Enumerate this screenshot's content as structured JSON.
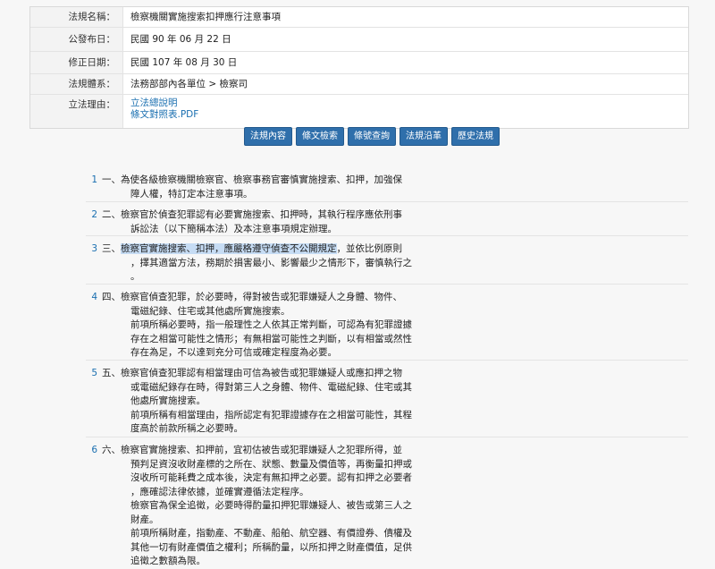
{
  "meta": {
    "rows": [
      {
        "label": "法規名稱：",
        "value": "檢察機關實施搜索扣押應行注意事項"
      },
      {
        "label": "公發布日：",
        "value": "民國 90 年 06 月 22 日"
      },
      {
        "label": "修正日期：",
        "value": "民國 107 年 08 月 30 日"
      },
      {
        "label": "法規體系：",
        "value": "法務部部內各單位 > 檢察司"
      }
    ],
    "reason_label": "立法理由：",
    "reason_links": [
      "立法總說明",
      "條文對照表.PDF"
    ]
  },
  "buttons": [
    "法規內容",
    "條文檢索",
    "條號查詢",
    "法規沿革",
    "歷史法規"
  ],
  "articles": [
    {
      "no": "1",
      "lines": [
        "一、為使各級檢察機關檢察官、檢察事務官審慎實施搜索、扣押，加強保",
        "障人權，特訂定本注意事項。"
      ]
    },
    {
      "no": "2",
      "lines": [
        "二、檢察官於偵查犯罪認有必要實施搜索、扣押時，其執行程序應依刑事",
        "訴訟法（以下簡稱本法）及本注意事項規定辦理。"
      ]
    },
    {
      "no": "3",
      "highlight": "檢察官實施搜索、扣押，應嚴格遵守偵查不公開規定",
      "first_rest": "，並依比例原則",
      "prefix": "三、",
      "lines": [
        "，擇其適當方法，務期於損害最小、影響最少之情形下，審慎執行之",
        "。"
      ]
    },
    {
      "no": "4",
      "lines": [
        "四、檢察官偵查犯罪，於必要時，得對被告或犯罪嫌疑人之身體、物件、",
        "電磁紀錄、住宅或其他處所實施搜索。",
        "前項所稱必要時，指一般理性之人依其正常判斷，可認為有犯罪證據",
        "存在之相當可能性之情形；有無相當可能性之判斷，以有相當或然性",
        "存在為足，不以達到充分可信或確定程度為必要。"
      ]
    },
    {
      "no": "5",
      "lines": [
        "五、檢察官偵查犯罪認有相當理由可信為被告或犯罪嫌疑人或應扣押之物",
        "或電磁紀錄存在時，得對第三人之身體、物件、電磁紀錄、住宅或其",
        "他處所實施搜索。",
        "前項所稱有相當理由，指所認定有犯罪證據存在之相當可能性，其程",
        "度高於前款所稱之必要時。"
      ]
    },
    {
      "no": "6",
      "lines": [
        "六、檢察官實施搜索、扣押前，宜初估被告或犯罪嫌疑人之犯罪所得，並",
        "預判足資沒收財產標的之所在、狀態、數量及價值等，再衡量扣押或",
        "沒收所可能耗費之成本後，決定有無扣押之必要。認有扣押之必要者",
        "，應確認法律依據，並確實遵循法定程序。",
        "檢察官為保全追徵，必要時得酌量扣押犯罪嫌疑人、被告或第三人之",
        "財產。",
        "前項所稱財產，指動產、不動產、船舶、航空器、有價證券、債權及",
        "其他一切有財產價值之權利；所稱酌量，以所扣押之財產價值，足供",
        "追徵之數額為限。"
      ]
    }
  ]
}
